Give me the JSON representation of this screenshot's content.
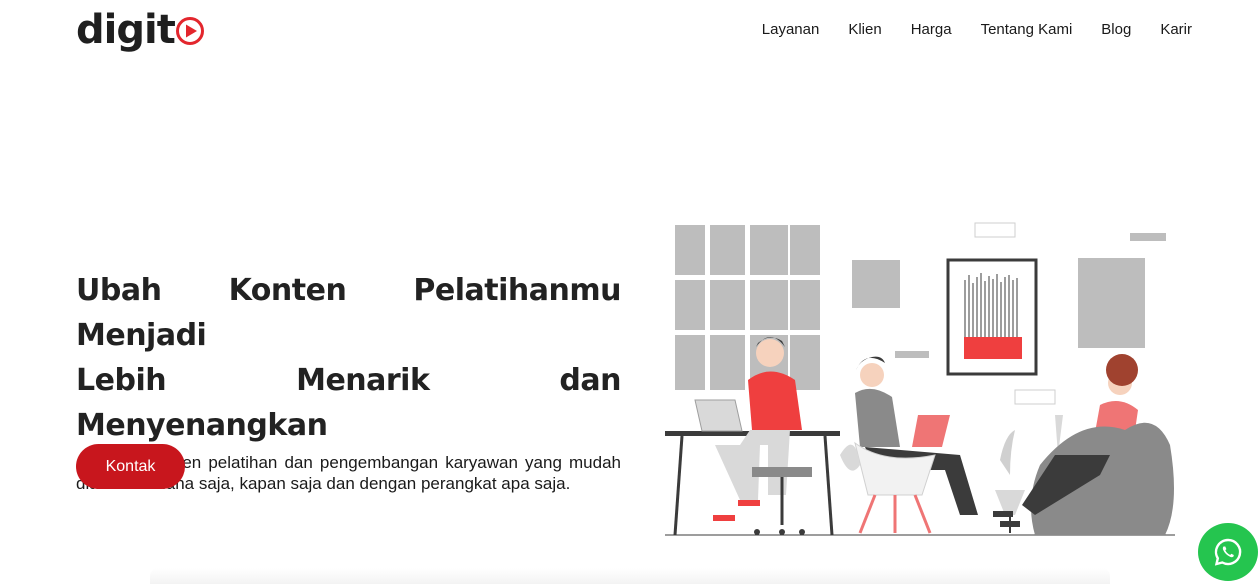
{
  "brand": {
    "name": "digit",
    "logo_icon": "play-icon",
    "accent": "#e3262d"
  },
  "nav": {
    "items": [
      {
        "label": "Layanan"
      },
      {
        "label": "Klien"
      },
      {
        "label": "Harga"
      },
      {
        "label": "Tentang Kami"
      },
      {
        "label": "Blog"
      },
      {
        "label": "Karir"
      }
    ]
  },
  "hero": {
    "title_line1": "Ubah Konten Pelatihanmu Menjadi",
    "title_line2": "Lebih Menarik dan Menyenangkan",
    "subtitle": "Ciptakan konten pelatihan dan pengembangan karyawan yang mudah diakses dimana saja, kapan saja dan dengan perangkat apa saja.",
    "cta_label": "Kontak",
    "cta_color": "#c8161d"
  },
  "floating": {
    "whatsapp_icon": "whatsapp-icon",
    "color": "#25c54f"
  }
}
